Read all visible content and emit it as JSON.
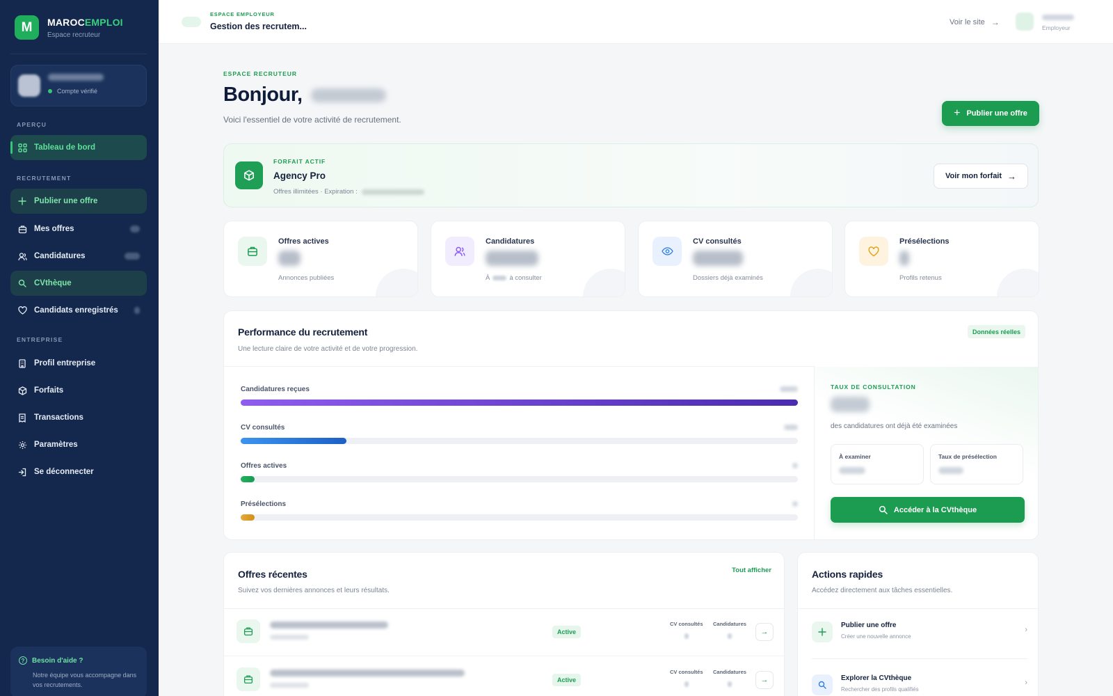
{
  "brand": {
    "logo_letter": "M",
    "name_part1": "MAROC",
    "name_part2": "EMPLOI",
    "subtitle": "Espace recruteur",
    "colors": {
      "sidebar": "#14284d",
      "accent": "#1c9c50",
      "accent_light": "#3ad17d"
    }
  },
  "account": {
    "status": "Compte vérifié"
  },
  "sidebar": {
    "sections": {
      "overview": "APERÇU",
      "recruitment": "RECRUTEMENT",
      "company": "ENTREPRISE"
    },
    "items": [
      {
        "label": "Tableau de bord",
        "icon": "dashboard-icon"
      },
      {
        "label": "Publier une offre",
        "icon": "plus-icon"
      },
      {
        "label": "Mes offres",
        "icon": "briefcase-icon"
      },
      {
        "label": "Candidatures",
        "icon": "users-icon"
      },
      {
        "label": "CVthèque",
        "icon": "search-icon"
      },
      {
        "label": "Candidats enregistrés",
        "icon": "heart-icon"
      },
      {
        "label": "Profil entreprise",
        "icon": "building-icon"
      },
      {
        "label": "Forfaits",
        "icon": "package-icon"
      },
      {
        "label": "Transactions",
        "icon": "receipt-icon"
      },
      {
        "label": "Paramètres",
        "icon": "gear-icon"
      },
      {
        "label": "Se déconnecter",
        "icon": "logout-icon"
      }
    ],
    "help": {
      "title": "Besoin d'aide ?",
      "description": "Notre équipe vous accompagne dans vos recrutements."
    }
  },
  "header": {
    "kicker": "ESPACE EMPLOYEUR",
    "title": "Gestion des recrutem...",
    "site_link": "Voir le site",
    "user_role": "Employeur"
  },
  "main": {
    "kicker": "ESPACE RECRUTEUR",
    "greeting": "Bonjour,",
    "subtitle": "Voici l'essentiel de votre activité de recrutement.",
    "publish_button": "Publier une offre"
  },
  "plan": {
    "kicker": "FORFAIT ACTIF",
    "name": "Agency Pro",
    "description": "Offres illimitées · Expiration :",
    "button": "Voir mon forfait"
  },
  "stats": [
    {
      "label": "Offres actives",
      "desc": "Annonces publiées",
      "icon": "briefcase-icon",
      "color": "#1b9d52",
      "bg": "#eaf7ef"
    },
    {
      "label": "Candidatures",
      "desc_prefix": "À",
      "desc_suffix": "à consulter",
      "icon": "users-icon",
      "color": "#8b5cf6",
      "bg": "#f1ecfe"
    },
    {
      "label": "CV consultés",
      "desc": "Dossiers déjà examinés",
      "icon": "eye-icon",
      "color": "#2b7de9",
      "bg": "#e8f1fd"
    },
    {
      "label": "Présélections",
      "desc": "Profils retenus",
      "icon": "heart-icon",
      "color": "#e0a422",
      "bg": "#fdf3df"
    }
  ],
  "performance": {
    "title": "Performance du recrutement",
    "subtitle": "Une lecture claire de votre activité et de votre progression.",
    "badge": "Données réelles",
    "bars": [
      {
        "label": "Candidatures reçues",
        "fraction": 1.0,
        "gradient": [
          "#8e5cf0",
          "#4b2bb0"
        ]
      },
      {
        "label": "CV consultés",
        "fraction": 0.19,
        "gradient": [
          "#3b94ee",
          "#1d5fc6"
        ]
      },
      {
        "label": "Offres actives",
        "fraction": 0.025,
        "gradient": [
          "#22b15f",
          "#1a9a50"
        ]
      },
      {
        "label": "Présélections",
        "fraction": 0.025,
        "gradient": [
          "#e8a93a",
          "#d08f16"
        ]
      }
    ],
    "rate": {
      "kicker": "TAUX DE CONSULTATION",
      "description": "des candidatures ont déjà été examinées",
      "to_review_label": "À examiner",
      "shortlist_rate_label": "Taux de présélection",
      "button": "Accéder à la CVthèque"
    }
  },
  "recent_offers": {
    "title": "Offres récentes",
    "subtitle": "Suivez vos dernières annonces et leurs résultats.",
    "view_all": "Tout afficher",
    "col_cv": "CV consultés",
    "col_applications": "Candidatures",
    "rows": [
      {
        "status": "Active"
      },
      {
        "status": "Active"
      }
    ]
  },
  "quick_actions": {
    "title": "Actions rapides",
    "subtitle": "Accédez directement aux tâches essentielles.",
    "items": [
      {
        "label": "Publier une offre",
        "desc": "Créer une nouvelle annonce",
        "icon": "plus-icon"
      },
      {
        "label": "Explorer la CVthèque",
        "desc": "Rechercher des profils qualifiés",
        "icon": "search-icon"
      }
    ]
  }
}
